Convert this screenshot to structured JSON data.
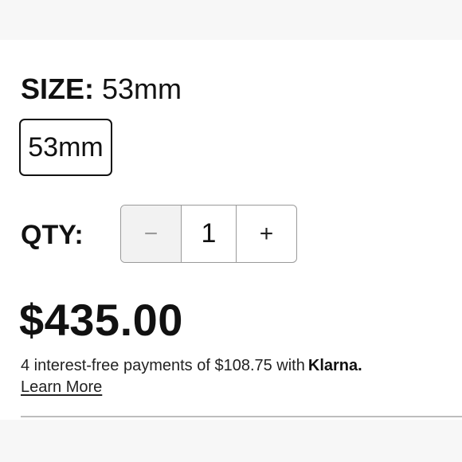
{
  "size": {
    "label": "SIZE:",
    "selected": "53mm",
    "options": [
      "53mm"
    ]
  },
  "quantity": {
    "label": "QTY:",
    "decrement": "−",
    "value": "1",
    "increment": "+"
  },
  "price": {
    "amount": "$435.00",
    "installment_text": "4 interest-free payments of $108.75 with",
    "provider": "Klarna.",
    "learn_more": "Learn More"
  }
}
